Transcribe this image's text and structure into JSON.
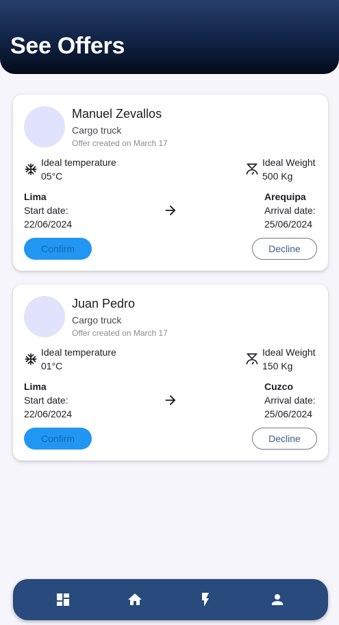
{
  "header": {
    "title": "See Offers"
  },
  "offers": [
    {
      "name": "Manuel Zevallos",
      "vehicle": "Cargo truck",
      "created": "Offer created on March 17",
      "temperature_label": "Ideal temperature",
      "temperature": "05°C",
      "weight_label": "Ideal Weight",
      "weight": "500 Kg",
      "origin": "Lima",
      "start_label": "Start date:",
      "start_date": "22/06/2024",
      "destination": "Arequipa",
      "arrival_label": "Arrival date:",
      "arrival_date": "25/06/2024",
      "confirm_label": "Confirm",
      "decline_label": "Decline"
    },
    {
      "name": "Juan Pedro",
      "vehicle": "Cargo truck",
      "created": "Offer created on March 17",
      "temperature_label": "Ideal temperature",
      "temperature": "01°C",
      "weight_label": "Ideal Weight",
      "weight": "150 Kg",
      "origin": "Lima",
      "start_label": "Start date:",
      "start_date": "22/06/2024",
      "destination": "Cuzco",
      "arrival_label": "Arrival date:",
      "arrival_date": "25/06/2024",
      "confirm_label": "Confirm",
      "decline_label": "Decline"
    }
  ],
  "icons": {
    "temperature": "snowflake-icon",
    "weight": "scale-icon",
    "route": "arrow-right-icon"
  },
  "bottom_nav": {
    "items": [
      {
        "icon": "dashboard-icon"
      },
      {
        "icon": "home-icon"
      },
      {
        "icon": "flash-icon"
      },
      {
        "icon": "person-icon"
      }
    ]
  },
  "colors": {
    "header_top": "#273f6e",
    "header_bottom": "#030b1c",
    "confirm_bg": "#2196f3",
    "nav_bg": "#284a7d",
    "avatar_bg": "#e1e2fb"
  }
}
